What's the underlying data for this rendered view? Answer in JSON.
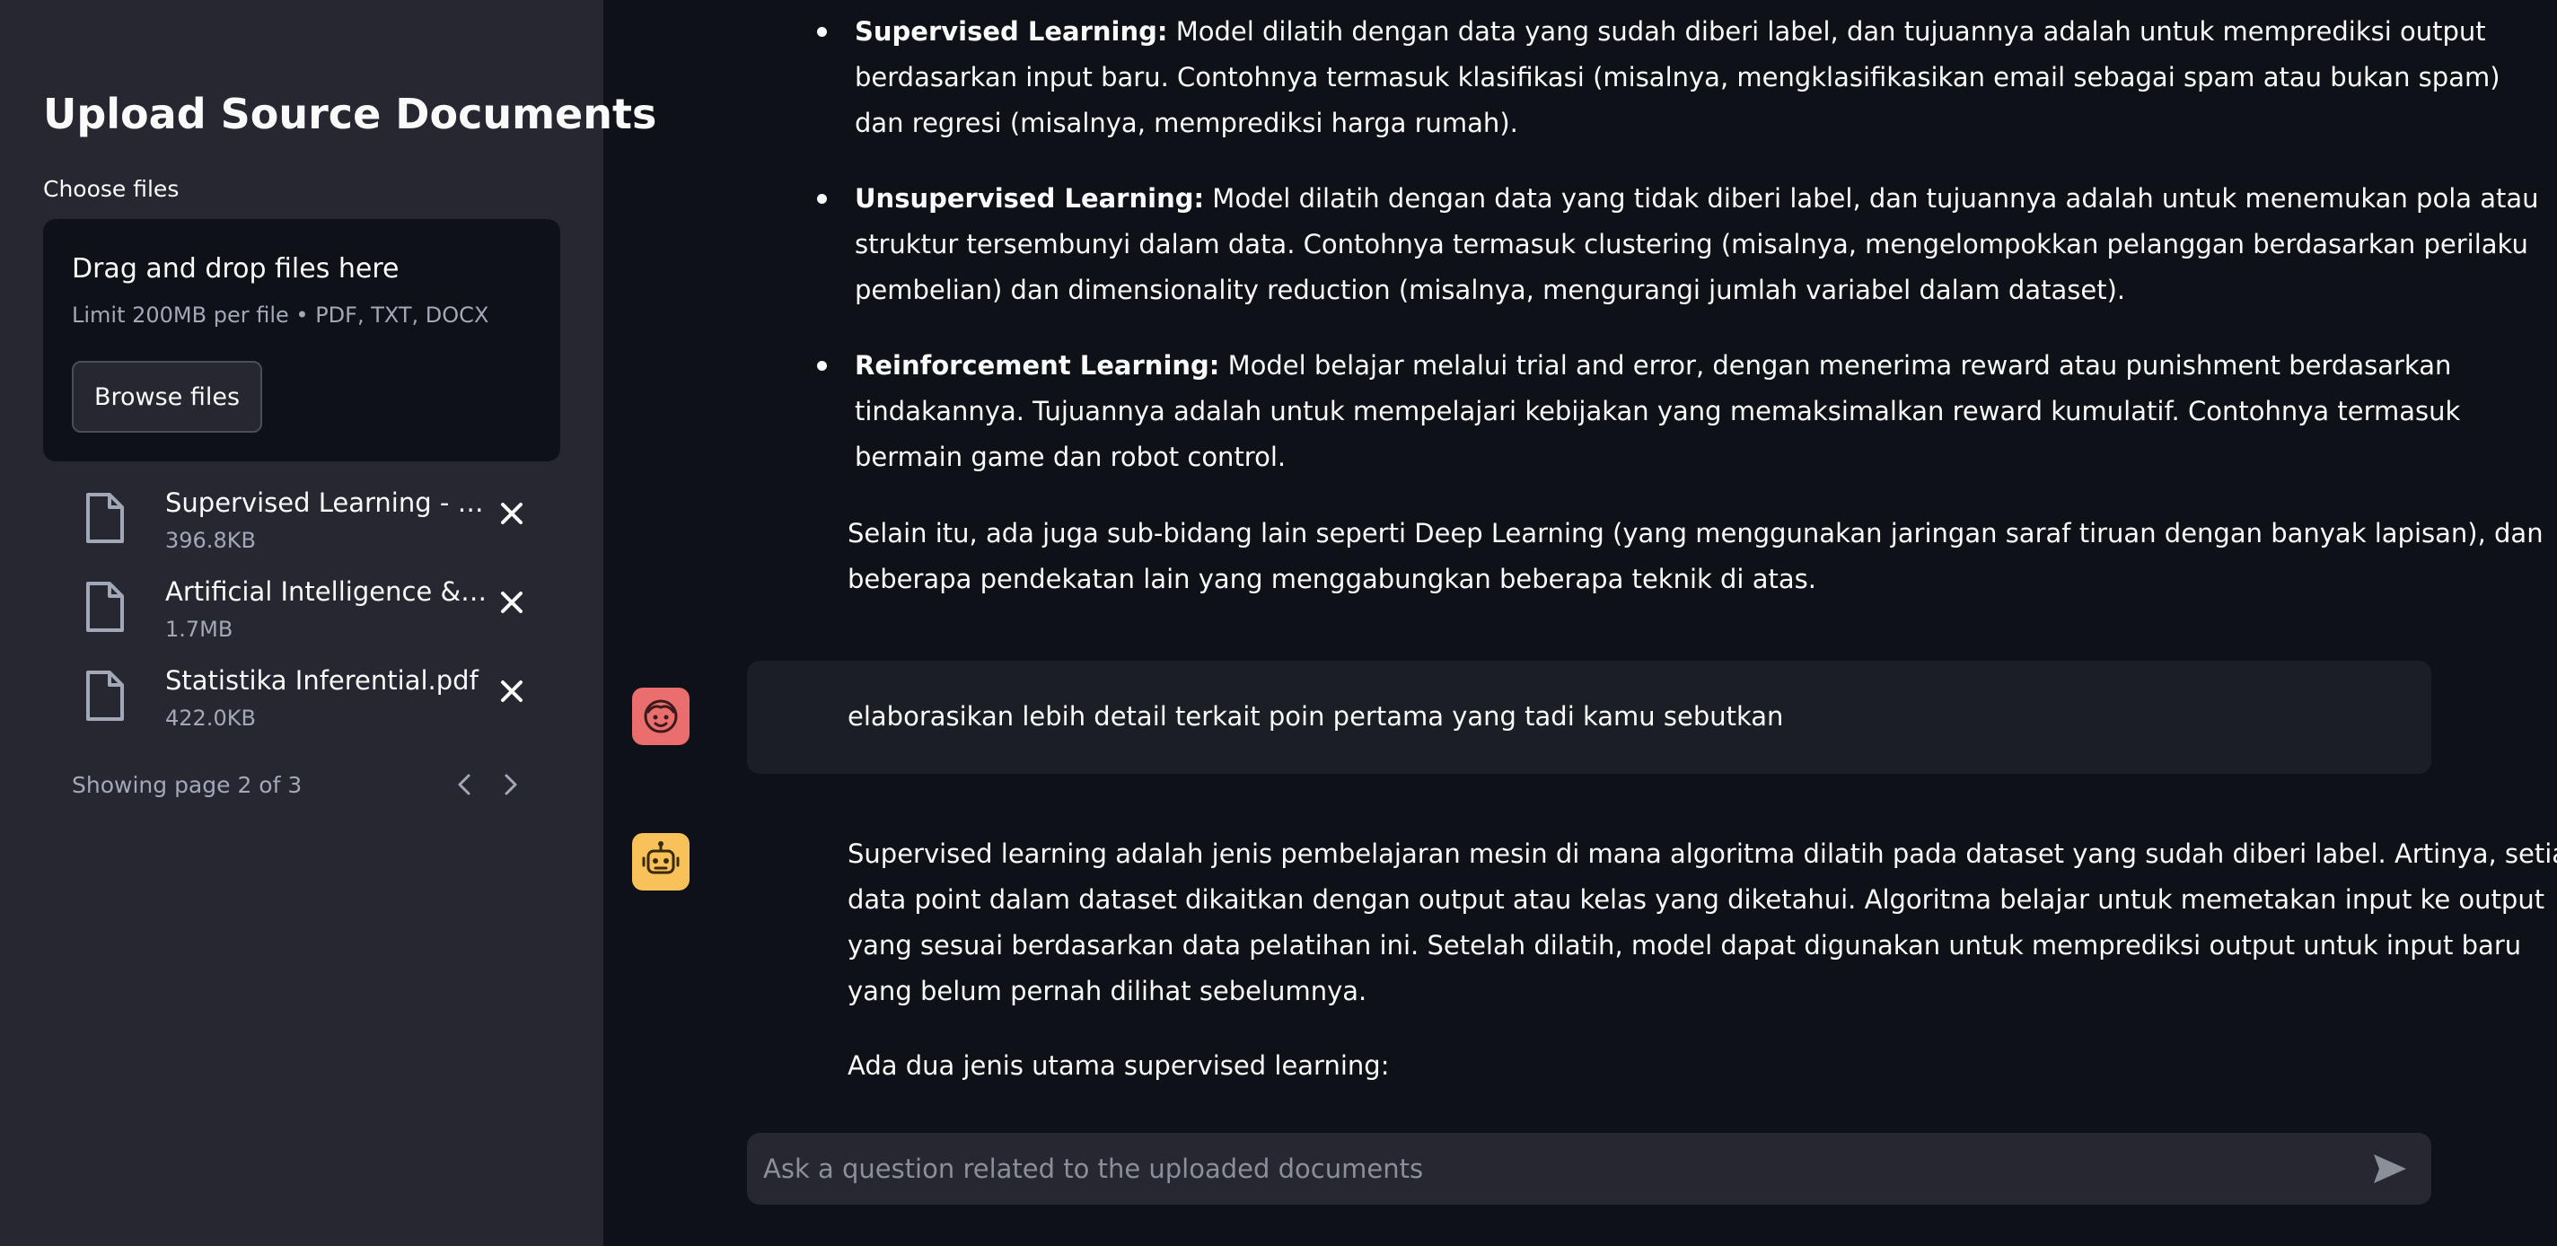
{
  "sidebar": {
    "title": "Upload Source Documents",
    "uploader_label": "Choose files",
    "dropzone": {
      "title": "Drag and drop files here",
      "limit": "Limit 200MB per file • PDF, TXT, DOCX",
      "browse_label": "Browse files"
    },
    "files": [
      {
        "name": "Supervised Learning - Cl...",
        "size": "396.8KB"
      },
      {
        "name": "Artificial Intelligence & M...",
        "size": "1.7MB"
      },
      {
        "name": "Statistika Inferential.pdf",
        "size": "422.0KB"
      }
    ],
    "pagination": "Showing page 2 of 3"
  },
  "chat": {
    "bullets": [
      {
        "term": "Supervised Learning:",
        "lines": [
          " Model dilatih dengan data yang sudah diberi label, dan tujuannya adalah untuk memprediksi output",
          "berdasarkan input baru. Contohnya termasuk klasifikasi (misalnya, mengklasifikasikan email sebagai spam atau bukan spam)",
          "dan regresi (misalnya, memprediksi harga rumah)."
        ]
      },
      {
        "term": "Unsupervised Learning:",
        "lines": [
          " Model dilatih dengan data yang tidak diberi label, dan tujuannya adalah untuk menemukan pola atau",
          "struktur tersembunyi dalam data. Contohnya termasuk clustering (misalnya, mengelompokkan pelanggan berdasarkan perilaku",
          "pembelian) dan dimensionality reduction (misalnya, mengurangi jumlah variabel dalam dataset)."
        ]
      },
      {
        "term": "Reinforcement Learning:",
        "lines": [
          " Model belajar melalui trial and error, dengan menerima reward atau punishment berdasarkan",
          "tindakannya. Tujuannya adalah untuk mempelajari kebijakan yang memaksimalkan reward kumulatif. Contohnya termasuk",
          "bermain game dan robot control."
        ]
      }
    ],
    "closing_paragraph": [
      "Selain itu, ada juga sub-bidang lain seperti Deep Learning (yang menggunakan jaringan saraf tiruan dengan banyak lapisan), dan",
      "beberapa pendekatan lain yang menggabungkan beberapa teknik di atas."
    ],
    "user_message": "elaborasikan lebih detail terkait poin pertama yang tadi kamu sebutkan",
    "assistant_reply": [
      "Supervised learning adalah jenis pembelajaran mesin di mana algoritma dilatih pada dataset yang sudah diberi label. Artinya, setiap",
      "data point dalam dataset dikaitkan dengan output atau kelas yang diketahui. Algoritma belajar untuk memetakan input ke output",
      "yang sesuai berdasarkan data pelatihan ini. Setelah dilatih, model dapat digunakan untuk memprediksi output untuk input baru",
      "yang belum pernah dilihat sebelumnya."
    ],
    "assistant_reply_2": "Ada dua jenis utama supervised learning:",
    "input_placeholder": "Ask a question related to the uploaded documents"
  },
  "icons": {
    "file": "file-icon",
    "remove": "close-icon",
    "prev": "chevron-left-icon",
    "next": "chevron-right-icon",
    "user_avatar": "face-icon",
    "bot_avatar": "robot-icon",
    "send": "send-icon"
  },
  "colors": {
    "sidebar_bg": "#262730",
    "main_bg": "#0e1117",
    "user_avatar": "#ea6e6e",
    "bot_avatar": "#f9c15a"
  }
}
